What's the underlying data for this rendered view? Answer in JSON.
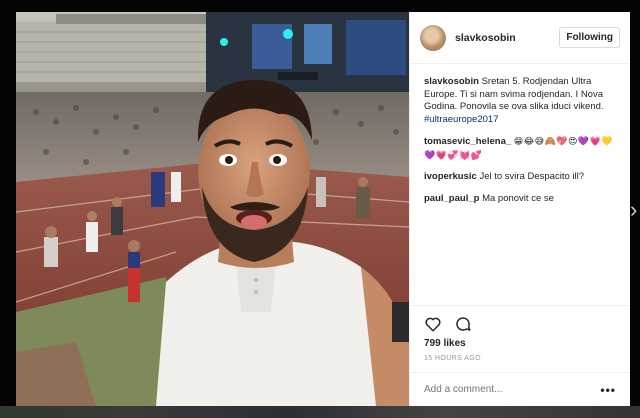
{
  "post": {
    "username": "slavkosobin",
    "follow_label": "Following",
    "caption": "Sretan 5. Rodjendan Ultra Europe. Ti si nam svima rodjendan. I Nova Godina. Ponovila se ova slika iduci vikend.",
    "hashtag": "#ultraeurope2017",
    "likes": "799 likes",
    "timestamp": "15 HOURS AGO",
    "add_comment_placeholder": "Add a comment...",
    "more_icon": "more-horizontal-icon",
    "photo_description_icon": "selfie-photo"
  },
  "comments": [
    {
      "username": "tomasevic_helena_",
      "text": "😁😂😅🙈💖😍💜💗💛💜💗💞💓💕"
    },
    {
      "username": "ivoperkusic",
      "text": "Jel to svira Despacito ill?"
    },
    {
      "username": "paul_paul_p",
      "text": "Ma ponovit ce se"
    }
  ],
  "icons": {
    "like": "heart-icon",
    "comment": "comment-icon"
  },
  "colors": {
    "hashtag": "#003569",
    "text": "#262626",
    "muted": "#999999",
    "border": "#efefef"
  }
}
